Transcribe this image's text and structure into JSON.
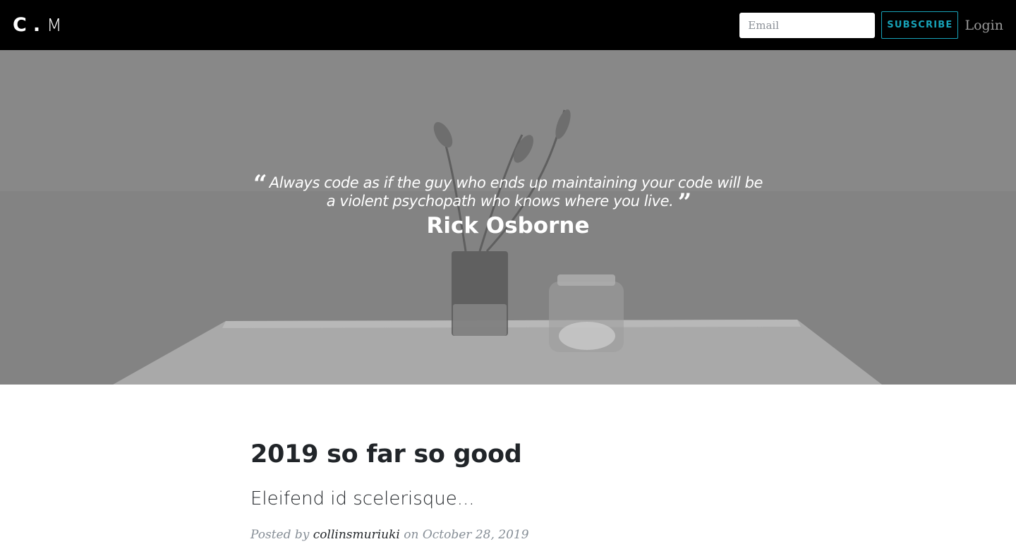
{
  "navbar": {
    "logo": {
      "letter": "C",
      "dot": ".",
      "second": "M"
    },
    "email": {
      "placeholder": "Email",
      "value": ""
    },
    "subscribe_label": "SUBSCRIBE",
    "login_label": "Login"
  },
  "hero": {
    "quote": "Always code as if the guy who ends up maintaining your code will be a violent psychopath who knows where you live.",
    "open_quote_icon": "quote-left-icon",
    "close_quote_icon": "quote-right-icon",
    "author": "Rick Osborne"
  },
  "post": {
    "title": "2019 so far so good",
    "subtitle": "Eleifend id scelerisque...",
    "meta_prefix": "Posted by",
    "author": "collinsmuriuki",
    "meta_on": "on",
    "date": "October 28, 2019"
  },
  "colors": {
    "navbar_bg": "#000000",
    "accent": "#17a2b8",
    "hero_overlay": "#7d7d7d",
    "text": "#212529",
    "muted": "#868e96"
  }
}
